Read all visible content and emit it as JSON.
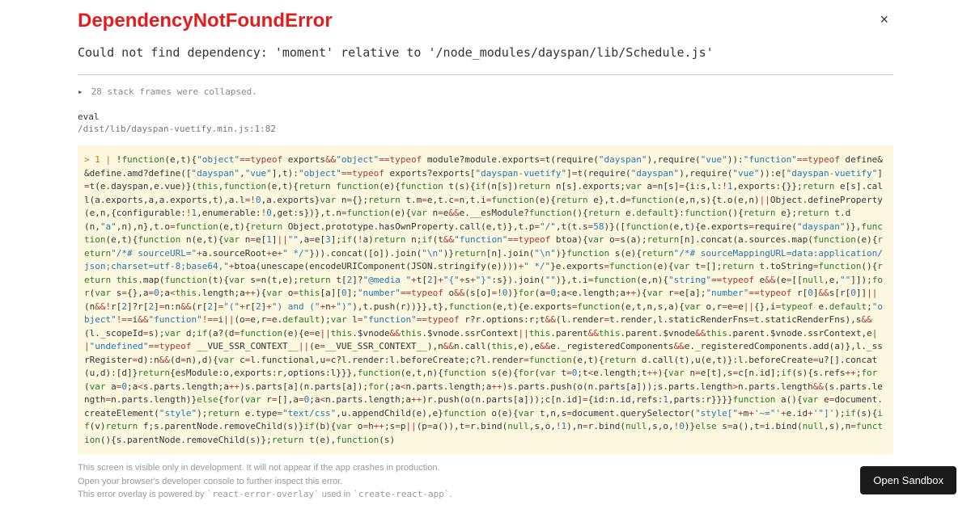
{
  "header": {
    "title": "DependencyNotFoundError",
    "close_glyph": "×"
  },
  "message": "Could not find dependency: 'moment' relative to '/node_modules/dayspan/lib/Schedule.js'",
  "stack": {
    "collapsed_label": "28 stack frames were collapsed.",
    "arrow": "▸",
    "eval_label": "eval",
    "eval_path": "/dist/lib/dayspan-vuetify.min.js:1:82"
  },
  "footer": {
    "line1": "This screen is visible only in development. It will not appear if the app crashes in production.",
    "line2": "Open your browser's developer console to further inspect this error.",
    "line3_prefix": "This error overlay is powered by ",
    "line3_pkg": "`react-error-overlay`",
    "line3_mid": " used in ",
    "line3_app": "`create-react-app`",
    "line3_suffix": "."
  },
  "sandbox_button": "Open Sandbox"
}
